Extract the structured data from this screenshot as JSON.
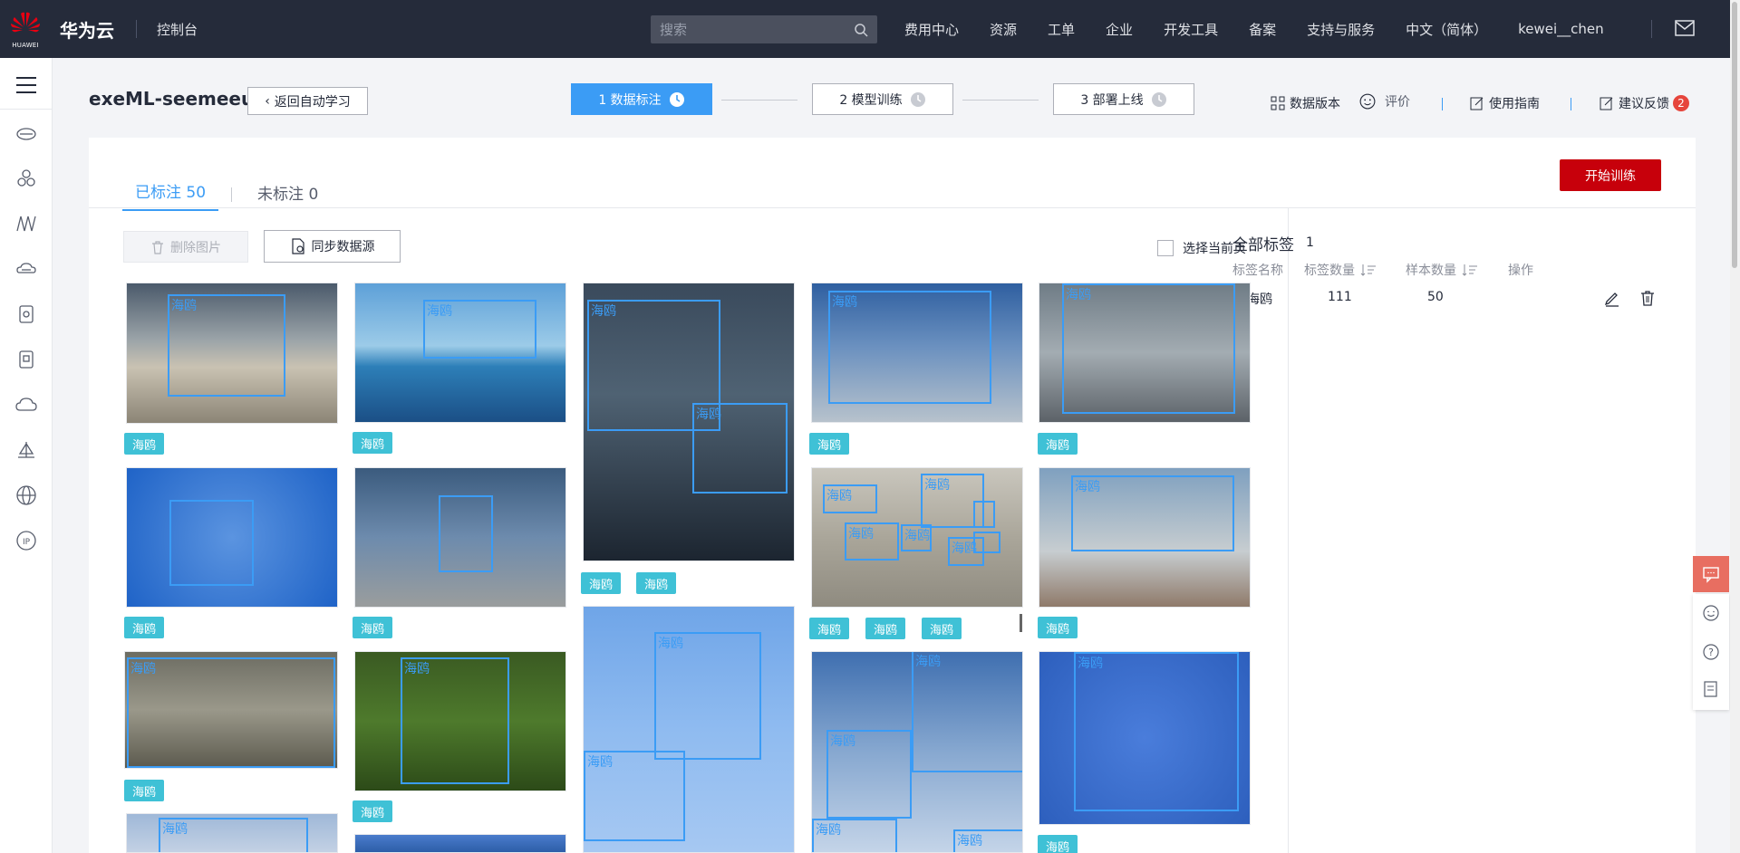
{
  "topbar": {
    "logo_text": "HUAWEI",
    "brand": "华为云",
    "console": "控制台",
    "search_placeholder": "搜索",
    "nav": [
      "费用中心",
      "资源",
      "工单",
      "企业",
      "开发工具",
      "备案",
      "支持与服务",
      "中文（简体）",
      "kewei__chen"
    ]
  },
  "sidebar": {
    "icons": [
      "menu-icon",
      "storage-icon",
      "cluster-icon",
      "network-icon",
      "cloud-db-icon",
      "container-icon",
      "docs-icon",
      "cloud-icon",
      "ship-icon",
      "globe-icon",
      "ip-icon"
    ]
  },
  "header": {
    "title": "exeML-seemeeu",
    "back_label": "返回自动学习",
    "steps": [
      "1 数据标注",
      "2 模型训练",
      "3 部署上线"
    ],
    "links": {
      "version": "数据版本",
      "rate": "评价",
      "guide": "使用指南",
      "feedback": "建议反馈",
      "feedback_badge": "2"
    }
  },
  "tabs": {
    "labeled": "已标注 50",
    "unlabeled": "未标注 0"
  },
  "actions": {
    "start_train": "开始训练",
    "delete_images": "删除图片",
    "sync_source": "同步数据源",
    "select_page": "选择当前页"
  },
  "gallery": {
    "tag": "海鸥",
    "box_label": "海鸥"
  },
  "labels_panel": {
    "title": "全部标签",
    "count": "1",
    "columns": [
      "标签名称",
      "标签数量",
      "样本数量",
      "操作"
    ],
    "rows": [
      {
        "name": "海鸥",
        "tag_count": "111",
        "sample_count": "50"
      }
    ]
  },
  "colors": {
    "topbar": "#252b3a",
    "accent": "#3b9cf5",
    "start_button": "#c7000b",
    "tag_chip": "#3fc1d6",
    "badge": "#e6453c"
  }
}
